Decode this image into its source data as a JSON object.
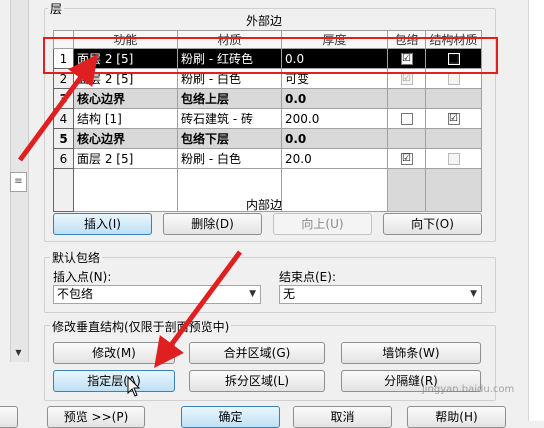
{
  "layers_label": "层",
  "exterior_side": "外部边",
  "interior_side": "内部边",
  "columns": [
    "",
    "功能",
    "材质",
    "厚度",
    "包络",
    "结构材质"
  ],
  "rows": [
    {
      "num": "1",
      "func": "面层 2 [5]",
      "mat": "粉刷 - 红砖色",
      "thick": "0.0",
      "wrap": "☑",
      "struct": "■",
      "style": "sel"
    },
    {
      "num": "2",
      "func": "面层 2 [5]",
      "mat": "粉刷 - 白色",
      "thick": "可变",
      "wrap": "☑",
      "struct": "",
      "style": "normal"
    },
    {
      "num": "3",
      "func": "核心边界",
      "mat": "包络上层",
      "thick": "0.0",
      "wrap": "",
      "struct": "",
      "style": "gray"
    },
    {
      "num": "4",
      "func": "结构 [1]",
      "mat": "砖石建筑 - 砖",
      "thick": "200.0",
      "wrap": "",
      "struct": "☑",
      "style": "normal"
    },
    {
      "num": "5",
      "func": "核心边界",
      "mat": "包络下层",
      "thick": "0.0",
      "wrap": "",
      "struct": "",
      "style": "gray"
    },
    {
      "num": "6",
      "func": "面层 2 [5]",
      "mat": "粉刷 - 白色",
      "thick": "20.0",
      "wrap": "☑",
      "struct": "",
      "style": "normal"
    }
  ],
  "buttons": {
    "insert": "插入(I)",
    "delete": "删除(D)",
    "up": "向上(U)",
    "down": "向下(O)"
  },
  "default_wrap": {
    "title": "默认包络",
    "insert_label": "插入点(N):",
    "insert_value": "不包络",
    "end_label": "结束点(E):",
    "end_value": "无"
  },
  "modify": {
    "title": "修改垂直结构(仅限于剖面预览中)",
    "modify": "修改(M)",
    "merge": "合并区域(G)",
    "sweeps": "墙饰条(W)",
    "assign": "指定层(A)",
    "split": "拆分区域(L)",
    "reveals": "分隔缝(R)"
  },
  "footer": {
    "preview": "预览 >>(P)",
    "ok": "确定",
    "cancel": "取消",
    "help": "帮助(H)"
  },
  "watermark": "jingyan.baidu.com",
  "colors": {
    "annotation": "#e02020",
    "selected_row": "#000000",
    "core_row": "#d9d9d9"
  }
}
